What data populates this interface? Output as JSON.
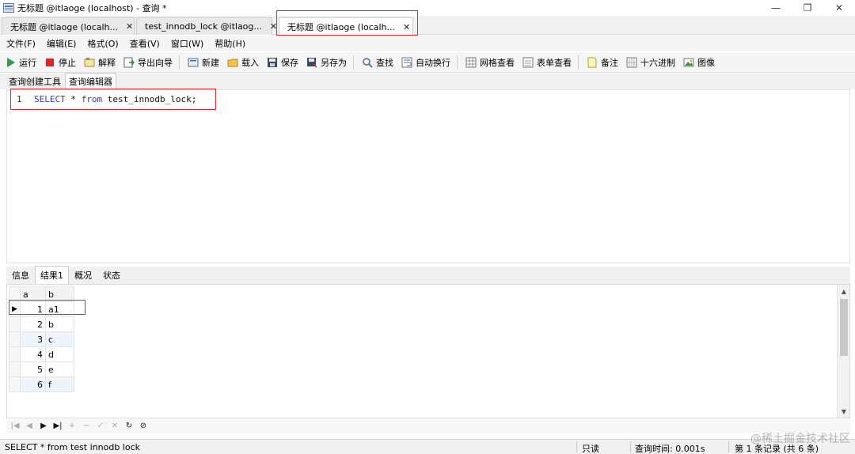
{
  "window": {
    "title": "无标题 @itlaoge (localhost) - 查询 *",
    "controls": [
      "—",
      "❐",
      "✕"
    ]
  },
  "doc_tabs": [
    {
      "label": "无标题 @itlaoge (localh...",
      "close": "✕",
      "active": false
    },
    {
      "label": "test_innodb_lock @itlaog...",
      "close": "✕",
      "active": false
    },
    {
      "label": "无标题 @itlaoge (localh...",
      "close": "✕",
      "active": true
    }
  ],
  "menu": [
    "文件(F)",
    "编辑(E)",
    "格式(O)",
    "查看(V)",
    "窗口(W)",
    "帮助(H)"
  ],
  "toolbar": {
    "run": "运行",
    "stop": "停止",
    "explain": "解释",
    "export": "导出向导",
    "new": "新建",
    "load": "载入",
    "save": "保存",
    "save_as": "另存为",
    "find": "查找",
    "wrap": "自动换行",
    "grid_view": "网格查看",
    "form_view": "表单查看",
    "note": "备注",
    "hex": "十六进制",
    "image": "图像"
  },
  "sub_tabs": [
    "查询创建工具",
    "查询编辑器"
  ],
  "editor": {
    "line": "1",
    "kw_select": "SELECT",
    "star": " * ",
    "kw_from": "from",
    "rest": " test_innodb_lock;"
  },
  "result_tabs": [
    "信息",
    "结果1",
    "概况",
    "状态"
  ],
  "grid": {
    "headers": [
      "a",
      "b"
    ],
    "rows": [
      {
        "a": "1",
        "b": "a1"
      },
      {
        "a": "2",
        "b": "b"
      },
      {
        "a": "3",
        "b": "c"
      },
      {
        "a": "4",
        "b": "d"
      },
      {
        "a": "5",
        "b": "e"
      },
      {
        "a": "6",
        "b": "f"
      }
    ],
    "current_row_marker": "▶"
  },
  "nav": [
    "|◀",
    "◀",
    "▶",
    "▶|",
    "+",
    "−",
    "✓",
    "✕",
    "↻",
    "⊘"
  ],
  "status": {
    "sql": "SELECT * from test innodb lock",
    "readonly": "只读",
    "query_time": "查询时间: 0.001s",
    "records": "第 1 条记录 (共 6 条)"
  },
  "watermark": "@稀土掘金技术社区",
  "colors": {
    "highlight": "#e0282e",
    "keyword": "#2a3ad1"
  }
}
